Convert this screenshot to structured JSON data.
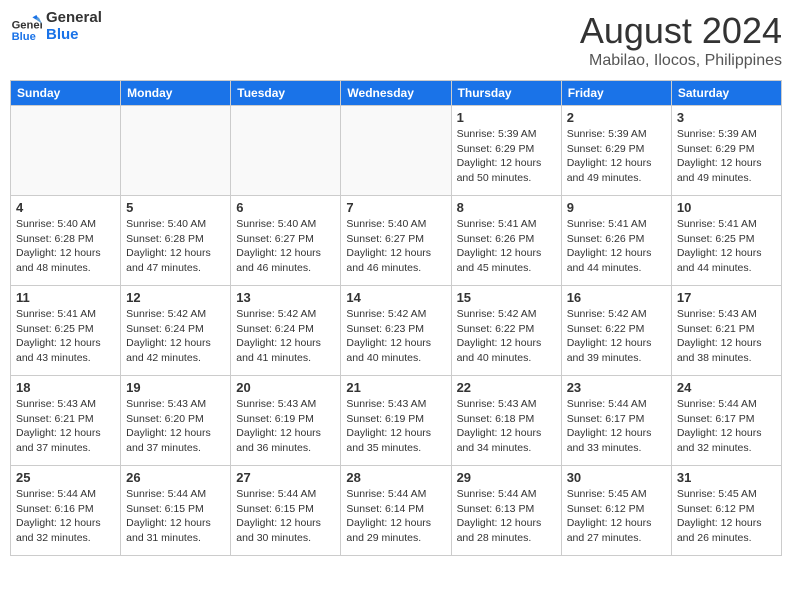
{
  "logo": {
    "text1": "General",
    "text2": "Blue"
  },
  "title": "August 2024",
  "location": "Mabilao, Ilocos, Philippines",
  "weekdays": [
    "Sunday",
    "Monday",
    "Tuesday",
    "Wednesday",
    "Thursday",
    "Friday",
    "Saturday"
  ],
  "weeks": [
    [
      {
        "day": "",
        "info": ""
      },
      {
        "day": "",
        "info": ""
      },
      {
        "day": "",
        "info": ""
      },
      {
        "day": "",
        "info": ""
      },
      {
        "day": "1",
        "info": "Sunrise: 5:39 AM\nSunset: 6:29 PM\nDaylight: 12 hours\nand 50 minutes."
      },
      {
        "day": "2",
        "info": "Sunrise: 5:39 AM\nSunset: 6:29 PM\nDaylight: 12 hours\nand 49 minutes."
      },
      {
        "day": "3",
        "info": "Sunrise: 5:39 AM\nSunset: 6:29 PM\nDaylight: 12 hours\nand 49 minutes."
      }
    ],
    [
      {
        "day": "4",
        "info": "Sunrise: 5:40 AM\nSunset: 6:28 PM\nDaylight: 12 hours\nand 48 minutes."
      },
      {
        "day": "5",
        "info": "Sunrise: 5:40 AM\nSunset: 6:28 PM\nDaylight: 12 hours\nand 47 minutes."
      },
      {
        "day": "6",
        "info": "Sunrise: 5:40 AM\nSunset: 6:27 PM\nDaylight: 12 hours\nand 46 minutes."
      },
      {
        "day": "7",
        "info": "Sunrise: 5:40 AM\nSunset: 6:27 PM\nDaylight: 12 hours\nand 46 minutes."
      },
      {
        "day": "8",
        "info": "Sunrise: 5:41 AM\nSunset: 6:26 PM\nDaylight: 12 hours\nand 45 minutes."
      },
      {
        "day": "9",
        "info": "Sunrise: 5:41 AM\nSunset: 6:26 PM\nDaylight: 12 hours\nand 44 minutes."
      },
      {
        "day": "10",
        "info": "Sunrise: 5:41 AM\nSunset: 6:25 PM\nDaylight: 12 hours\nand 44 minutes."
      }
    ],
    [
      {
        "day": "11",
        "info": "Sunrise: 5:41 AM\nSunset: 6:25 PM\nDaylight: 12 hours\nand 43 minutes."
      },
      {
        "day": "12",
        "info": "Sunrise: 5:42 AM\nSunset: 6:24 PM\nDaylight: 12 hours\nand 42 minutes."
      },
      {
        "day": "13",
        "info": "Sunrise: 5:42 AM\nSunset: 6:24 PM\nDaylight: 12 hours\nand 41 minutes."
      },
      {
        "day": "14",
        "info": "Sunrise: 5:42 AM\nSunset: 6:23 PM\nDaylight: 12 hours\nand 40 minutes."
      },
      {
        "day": "15",
        "info": "Sunrise: 5:42 AM\nSunset: 6:22 PM\nDaylight: 12 hours\nand 40 minutes."
      },
      {
        "day": "16",
        "info": "Sunrise: 5:42 AM\nSunset: 6:22 PM\nDaylight: 12 hours\nand 39 minutes."
      },
      {
        "day": "17",
        "info": "Sunrise: 5:43 AM\nSunset: 6:21 PM\nDaylight: 12 hours\nand 38 minutes."
      }
    ],
    [
      {
        "day": "18",
        "info": "Sunrise: 5:43 AM\nSunset: 6:21 PM\nDaylight: 12 hours\nand 37 minutes."
      },
      {
        "day": "19",
        "info": "Sunrise: 5:43 AM\nSunset: 6:20 PM\nDaylight: 12 hours\nand 37 minutes."
      },
      {
        "day": "20",
        "info": "Sunrise: 5:43 AM\nSunset: 6:19 PM\nDaylight: 12 hours\nand 36 minutes."
      },
      {
        "day": "21",
        "info": "Sunrise: 5:43 AM\nSunset: 6:19 PM\nDaylight: 12 hours\nand 35 minutes."
      },
      {
        "day": "22",
        "info": "Sunrise: 5:43 AM\nSunset: 6:18 PM\nDaylight: 12 hours\nand 34 minutes."
      },
      {
        "day": "23",
        "info": "Sunrise: 5:44 AM\nSunset: 6:17 PM\nDaylight: 12 hours\nand 33 minutes."
      },
      {
        "day": "24",
        "info": "Sunrise: 5:44 AM\nSunset: 6:17 PM\nDaylight: 12 hours\nand 32 minutes."
      }
    ],
    [
      {
        "day": "25",
        "info": "Sunrise: 5:44 AM\nSunset: 6:16 PM\nDaylight: 12 hours\nand 32 minutes."
      },
      {
        "day": "26",
        "info": "Sunrise: 5:44 AM\nSunset: 6:15 PM\nDaylight: 12 hours\nand 31 minutes."
      },
      {
        "day": "27",
        "info": "Sunrise: 5:44 AM\nSunset: 6:15 PM\nDaylight: 12 hours\nand 30 minutes."
      },
      {
        "day": "28",
        "info": "Sunrise: 5:44 AM\nSunset: 6:14 PM\nDaylight: 12 hours\nand 29 minutes."
      },
      {
        "day": "29",
        "info": "Sunrise: 5:44 AM\nSunset: 6:13 PM\nDaylight: 12 hours\nand 28 minutes."
      },
      {
        "day": "30",
        "info": "Sunrise: 5:45 AM\nSunset: 6:12 PM\nDaylight: 12 hours\nand 27 minutes."
      },
      {
        "day": "31",
        "info": "Sunrise: 5:45 AM\nSunset: 6:12 PM\nDaylight: 12 hours\nand 26 minutes."
      }
    ]
  ]
}
